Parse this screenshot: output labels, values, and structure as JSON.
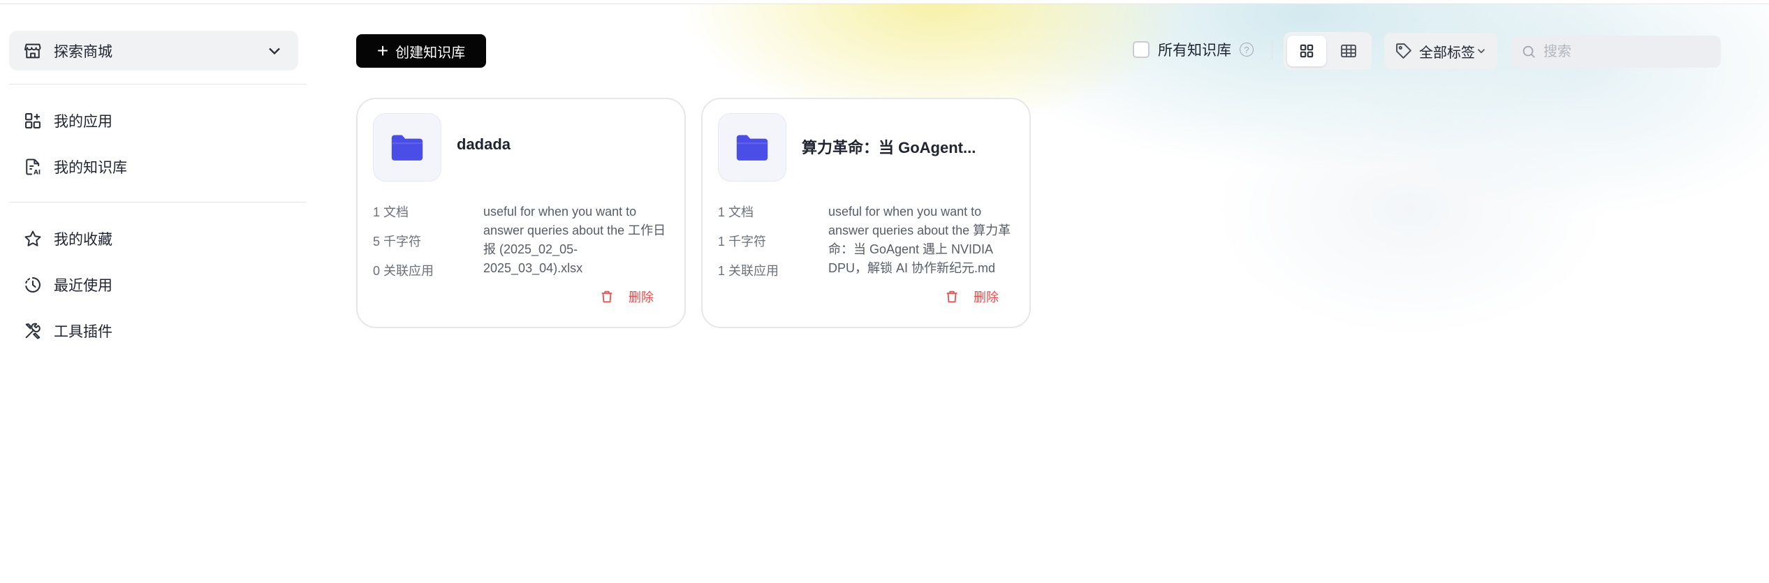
{
  "sidebar": {
    "explore_label": "探索商城",
    "items": [
      {
        "label": "我的应用",
        "icon": "apps-icon"
      },
      {
        "label": "我的知识库",
        "icon": "knowledge-doc-icon"
      },
      {
        "label": "我的收藏",
        "icon": "star-icon"
      },
      {
        "label": "最近使用",
        "icon": "history-icon"
      },
      {
        "label": "工具插件",
        "icon": "tools-icon"
      }
    ]
  },
  "toolbar": {
    "create_label": "创建知识库",
    "all_kb_label": "所有知识库",
    "help_glyph": "?",
    "tag_filter_label": "全部标签",
    "search_placeholder": "搜索",
    "active_view": "grid"
  },
  "cards": [
    {
      "title": "dadada",
      "docs": "1 文档",
      "chars": "5 千字符",
      "apps": "0 关联应用",
      "description": "useful for when you want to answer queries about the 工作日报 (2025_02_05-2025_03_04).xlsx",
      "delete_label": "删除"
    },
    {
      "title": "算力革命：当 GoAgent...",
      "docs": "1 文档",
      "chars": "1 千字符",
      "apps": "1 关联应用",
      "description": "useful for when you want to answer queries about the 算力革命：当 GoAgent 遇上 NVIDIA DPU，解锁 AI 协作新纪元.md",
      "delete_label": "删除"
    }
  ],
  "colors": {
    "accent": "#4a4de6",
    "danger": "#ea4b4b",
    "primary_button": "#050505"
  }
}
